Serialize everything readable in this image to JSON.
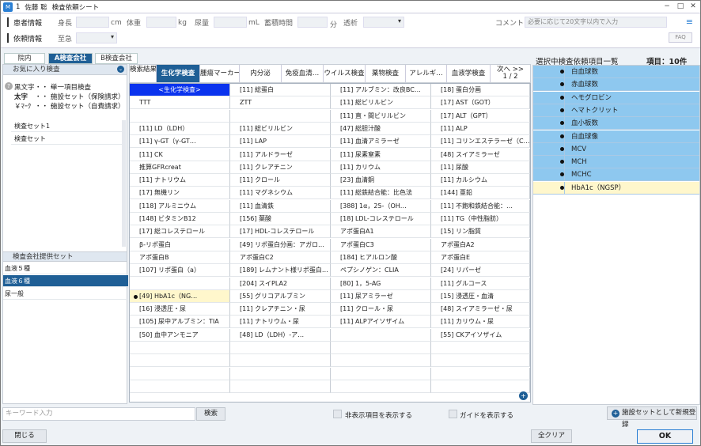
{
  "window": {
    "title_num": "1",
    "patient_name": "佐藤 聡",
    "title": "検査依頼シート"
  },
  "header": {
    "patient_label": "患者情報",
    "height_label": "身長",
    "height_unit": "cm",
    "weight_label": "体重",
    "weight_unit": "kg",
    "urine_label": "尿量",
    "urine_unit": "mL",
    "collection_label": "蓄積時間",
    "collection_unit": "分",
    "dialysis_label": "透析",
    "comment_label": "コメント",
    "comment_placeholder": "必要に応じて20文字以内で入力",
    "request_label": "依頼情報",
    "urgent_label": "至急",
    "faq": "FAQ"
  },
  "tabs": [
    "院内",
    "A検査会社",
    "B検査会社"
  ],
  "left": {
    "favorites_title": "お気に入り検査",
    "legend": [
      [
        "黒文字",
        "・・・",
        "単一項目検査"
      ],
      [
        "太字",
        "・・・",
        "施設セット（保険請求）"
      ],
      [
        "￥ﾏｰｸ",
        "・・・",
        "施設セット（自費請求）"
      ]
    ],
    "sets": [
      "検査セット1",
      "検査セット"
    ],
    "company_title": "検査会社提供セット",
    "company_sets": [
      "血液５種",
      "血液６種",
      "尿一般"
    ]
  },
  "categories": [
    "検索結果",
    "生化学検査",
    "腫瘍マーカー",
    "内分泌",
    "免疫血清…",
    "ウイルス検査",
    "薬物検査",
    "アレルギ…",
    "血液学検査",
    "次へ >>",
    "1 / 2"
  ],
  "grid": [
    [
      "<生化学検査>",
      "[11] 総蛋白",
      "[11] アルブミン：改良BC…",
      "[18] 蛋白分画"
    ],
    [
      "TTT",
      "ZTT",
      "[11] 総ビリルビン",
      "[17] AST（GOT）"
    ],
    [
      "",
      "",
      "[11] 直・間ビリルビン",
      "[17] ALT（GPT）"
    ],
    [
      "[11] LD（LDH）",
      "[11] 総ビリルビン",
      "[47] 総胆汁酸",
      "[11] ALP"
    ],
    [
      "[11] γ-GT（γ-GT…",
      "[11] LAP",
      "[11] 血清アミラーゼ",
      "[11] コリンエステラーゼ（C…"
    ],
    [
      "[11] CK",
      "[11] アルドラーゼ",
      "[11] 尿素窒素",
      "[48] スイアミラーゼ"
    ],
    [
      "推算GFRcreat",
      "[11] クレアチニン",
      "[11] カリウム",
      "[11] 尿酸"
    ],
    [
      "[11] ナトリウム",
      "[11] クロール",
      "[23] 血清銅",
      "[11] カルシウム"
    ],
    [
      "[17] 無機リン",
      "[11] マグネシウム",
      "[11] 総鉄結合能：比色法",
      "[144] 亜鉛"
    ],
    [
      "[118] アルミニウム",
      "[11] 血清鉄",
      "[388] 1α，25-（OH…",
      "[11] 不飽和鉄結合能：…"
    ],
    [
      "[148] ビタミンB12",
      "[156] 葉酸",
      "[18] LDL-コレステロール",
      "[11] TG（中性脂肪）"
    ],
    [
      "[17] 総コレステロール",
      "[17] HDL-コレステロール",
      "アポ蛋白A1",
      "[15] リン脂質"
    ],
    [
      "β-リポ蛋白",
      "[49] リポ蛋白分画：アガロ…",
      "アポ蛋白C3",
      "アポ蛋白A2"
    ],
    [
      "アポ蛋白B",
      "アポ蛋白C2",
      "[184] ヒアルロン酸",
      "アポ蛋白E"
    ],
    [
      "[107] リポ蛋白（a）",
      "[189] レムナント様リポ蛋白…",
      "ペプシノゲン：CLIA",
      "[24] リパーゼ"
    ],
    [
      "",
      "[204] スイPLA2",
      "[80] 1，5-AG",
      "[11] グルコース"
    ],
    [
      "[49] HbA1c（NG…",
      "[55] グリコアルブミン",
      "[11] 尿アミラーゼ",
      "[15] 浸透圧・血清"
    ],
    [
      "[16] 浸透圧・尿",
      "[11] クレアチニン・尿",
      "[11] クロール・尿",
      "[48] スイアミラーゼ・尿"
    ],
    [
      "[105] 尿中アルブミン：TIA",
      "[11] ナトリウム・尿",
      "[11] ALPアイソザイム",
      "[11] カリウム・尿"
    ],
    [
      "[50] 血中アンモニア",
      "[48] LD（LDH）-ア…",
      "",
      "[55] CKアイソザイム"
    ]
  ],
  "right": {
    "title": "選択中検査依頼項目一覧",
    "count": "項目：10件",
    "items": [
      "白血球数",
      "赤血球数",
      "ヘモグロビン",
      "ヘマトクリット",
      "血小板数",
      "白血球像",
      "MCV",
      "MCH",
      "MCHC",
      "HbA1c（NGSP）"
    ]
  },
  "bottom": {
    "keyword_placeholder": "キーワード入力",
    "search": "検索",
    "show_hidden": "非表示項目を表示する",
    "show_guide": "ガイドを表示する",
    "register": "施設セットとして新規登録",
    "close": "閉じる",
    "clear": "全クリア",
    "ok": "OK"
  }
}
